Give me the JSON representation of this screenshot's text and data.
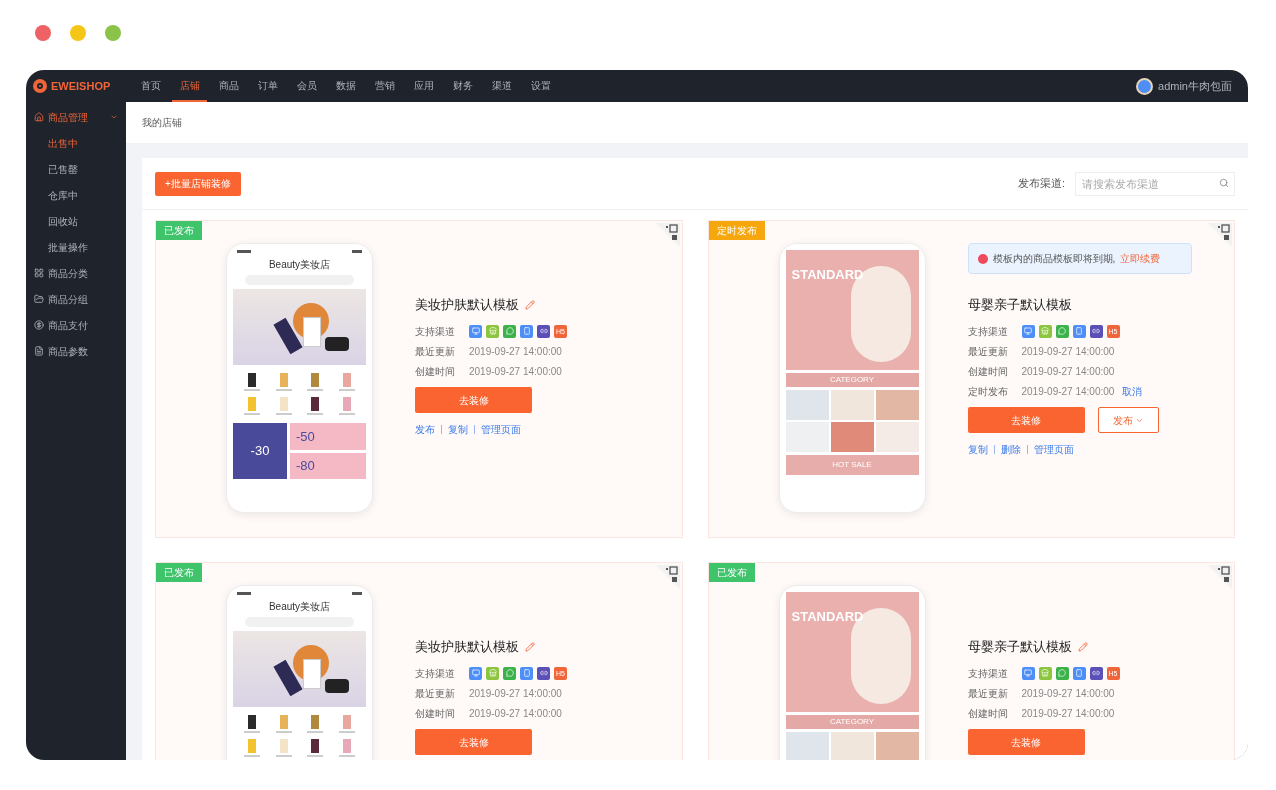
{
  "window_dots": [
    {
      "color": "#ee6266"
    },
    {
      "color": "#f5c518"
    },
    {
      "color": "#8bc34a"
    }
  ],
  "brand": "EWEISHOP",
  "nav": [
    {
      "label": "首页",
      "selected": false
    },
    {
      "label": "店铺",
      "selected": true
    },
    {
      "label": "商品",
      "selected": false
    },
    {
      "label": "订单",
      "selected": false
    },
    {
      "label": "会员",
      "selected": false
    },
    {
      "label": "数据",
      "selected": false
    },
    {
      "label": "营销",
      "selected": false
    },
    {
      "label": "应用",
      "selected": false
    },
    {
      "label": "财务",
      "selected": false
    },
    {
      "label": "渠道",
      "selected": false
    },
    {
      "label": "设置",
      "selected": false
    }
  ],
  "user": {
    "name": "admin牛肉包面"
  },
  "sidebar": {
    "items": [
      {
        "label": "商品管理",
        "expanded": true,
        "children": [
          {
            "label": "出售中",
            "selected": true
          },
          {
            "label": "已售罄",
            "selected": false
          },
          {
            "label": "仓库中",
            "selected": false
          },
          {
            "label": "回收站",
            "selected": false
          },
          {
            "label": "批量操作",
            "selected": false
          }
        ]
      },
      {
        "label": "商品分类",
        "expanded": false
      },
      {
        "label": "商品分组",
        "expanded": false
      },
      {
        "label": "商品支付",
        "expanded": false
      },
      {
        "label": "商品参数",
        "expanded": false
      }
    ]
  },
  "breadcrumb": "我的店铺",
  "toolbar": {
    "add_button": "+批量店铺装修",
    "filter_label": "发布渠道:",
    "search": {
      "placeholder": "请搜索发布渠道"
    }
  },
  "templates": [
    {
      "status": {
        "label": "已发布",
        "kind": "published"
      },
      "preview": {
        "kind": "beauty",
        "header": "Beauty美妆店",
        "coupons": [
          "-30",
          "-50",
          "-80"
        ]
      },
      "title": "美妆护肤默认模板",
      "editable": true,
      "channels_label": "支持渠道",
      "channels": [
        {
          "color": "#4d8ef7"
        },
        {
          "color": "#8cc63f"
        },
        {
          "color": "#3cb34a"
        },
        {
          "color": "#4d8ef7"
        },
        {
          "color": "#5b4fb8"
        },
        {
          "color": "#f0653a",
          "label": "H5"
        }
      ],
      "rows": [
        {
          "label": "最近更新",
          "value": "2019-09-27 14:00:00"
        },
        {
          "label": "创建时间",
          "value": "2019-09-27 14:00:00"
        }
      ],
      "primary_button": "去装修",
      "links": [
        "发布",
        "复制",
        "管理页面"
      ]
    },
    {
      "status": {
        "label": "定时发布",
        "kind": "scheduled"
      },
      "preview": {
        "kind": "mother",
        "banner": "STANDARD",
        "category": "CATEGORY",
        "footer": "HOT SALE"
      },
      "alert": {
        "text": "模板内的商品模板即将到期,",
        "link": "立即续费"
      },
      "title": "母婴亲子默认模板",
      "editable": false,
      "channels_label": "支持渠道",
      "channels": [
        {
          "color": "#4d8ef7"
        },
        {
          "color": "#8cc63f"
        },
        {
          "color": "#3cb34a"
        },
        {
          "color": "#4d8ef7"
        },
        {
          "color": "#5b4fb8"
        },
        {
          "color": "#f0653a",
          "label": "H5"
        }
      ],
      "rows": [
        {
          "label": "最近更新",
          "value": "2019-09-27 14:00:00"
        },
        {
          "label": "创建时间",
          "value": "2019-09-27 14:00:00"
        },
        {
          "label": "定时发布",
          "value": "2019-09-27 14:00:00",
          "action": "取消"
        }
      ],
      "primary_button": "去装修",
      "secondary_button": "发布",
      "links": [
        "复制",
        "删除",
        "管理页面"
      ]
    },
    {
      "status": {
        "label": "已发布",
        "kind": "published"
      },
      "preview": {
        "kind": "beauty",
        "header": "Beauty美妆店"
      },
      "title": "美妆护肤默认模板",
      "editable": true,
      "channels_label": "支持渠道",
      "channels": [
        {
          "color": "#4d8ef7"
        },
        {
          "color": "#8cc63f"
        },
        {
          "color": "#3cb34a"
        },
        {
          "color": "#4d8ef7"
        },
        {
          "color": "#5b4fb8"
        },
        {
          "color": "#f0653a",
          "label": "H5"
        }
      ],
      "rows": [
        {
          "label": "最近更新",
          "value": "2019-09-27 14:00:00"
        },
        {
          "label": "创建时间",
          "value": "2019-09-27 14:00:00"
        }
      ],
      "primary_button": "去装修"
    },
    {
      "status": {
        "label": "已发布",
        "kind": "published"
      },
      "preview": {
        "kind": "mother",
        "banner": "STANDARD",
        "category": "CATEGORY"
      },
      "title": "母婴亲子默认模板",
      "editable": true,
      "channels_label": "支持渠道",
      "channels": [
        {
          "color": "#4d8ef7"
        },
        {
          "color": "#8cc63f"
        },
        {
          "color": "#3cb34a"
        },
        {
          "color": "#4d8ef7"
        },
        {
          "color": "#5b4fb8"
        },
        {
          "color": "#f0653a",
          "label": "H5"
        }
      ],
      "rows": [
        {
          "label": "最近更新",
          "value": "2019-09-27 14:00:00"
        },
        {
          "label": "创建时间",
          "value": "2019-09-27 14:00:00"
        }
      ],
      "primary_button": "去装修"
    }
  ]
}
